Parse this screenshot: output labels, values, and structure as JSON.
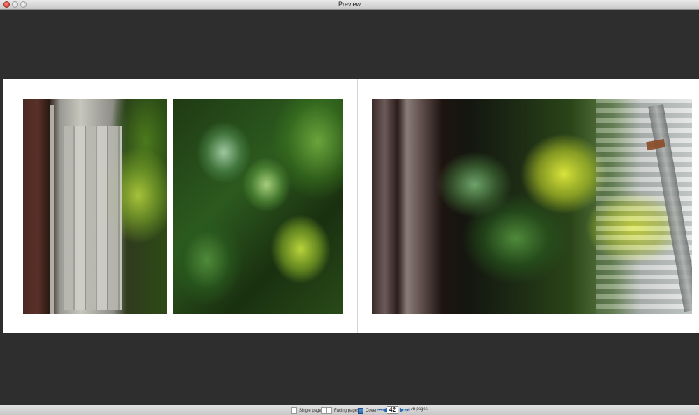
{
  "window": {
    "title": "Preview"
  },
  "bottombar": {
    "single_pages_label": "Single pages",
    "facing_pages_label": "Facing pages",
    "cover_label": "Cover",
    "page_number": "42",
    "page_count": "76 pages"
  },
  "icons": {
    "first": "first-page-icon",
    "prev": "previous-page-icon",
    "next": "next-page-icon",
    "last": "last-page-icon"
  },
  "colors": {
    "accent": "#2a6ab0",
    "viewer_bg": "#2e2e2e",
    "page_bg": "#ffffff"
  }
}
